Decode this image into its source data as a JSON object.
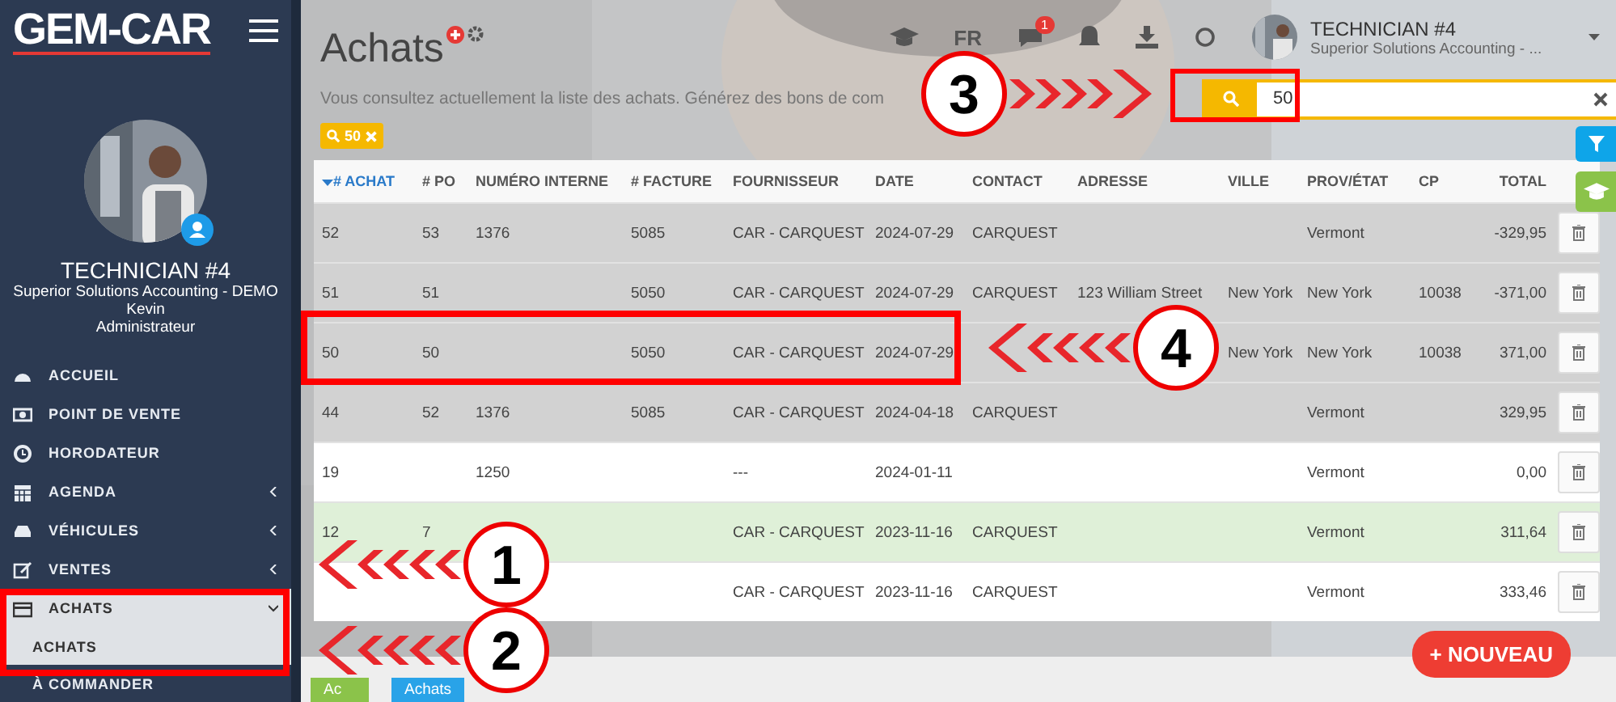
{
  "sidebar": {
    "logo": "GEM-CAR",
    "user_name": "TECHNICIAN #4",
    "company": "Superior Solutions Accounting - DEMO",
    "person": "Kevin",
    "role": "Administrateur",
    "menu": [
      {
        "label": "ACCUEIL",
        "kind": "link",
        "selected": false
      },
      {
        "label": "POINT DE VENTE",
        "kind": "link",
        "selected": false
      },
      {
        "label": "HORODATEUR",
        "kind": "link",
        "selected": false
      },
      {
        "label": "AGENDA",
        "kind": "group",
        "expanded": false,
        "selected": false
      },
      {
        "label": "VÉHICULES",
        "kind": "group",
        "expanded": false,
        "selected": false
      },
      {
        "label": "VENTES",
        "kind": "group",
        "expanded": false,
        "selected": false
      },
      {
        "label": "ACHATS",
        "kind": "group",
        "expanded": true,
        "selected": true,
        "children": [
          {
            "label": "ACHATS",
            "selected": true
          },
          {
            "label": "À COMMANDER",
            "selected": false
          }
        ]
      }
    ]
  },
  "header": {
    "language": "FR",
    "notification_count": "1",
    "user_name": "TECHNICIAN #4",
    "company": "Superior Solutions Accounting - ..."
  },
  "page": {
    "title": "Achats",
    "subtitle": "Vous consultez actuellement la liste des achats. Générez des bons de com",
    "filter_chip": "50"
  },
  "search": {
    "value": "50"
  },
  "table": {
    "columns": [
      {
        "label": "# ACHAT",
        "sorted": true
      },
      {
        "label": "# PO",
        "sorted": false
      },
      {
        "label": "NUMÉRO INTERNE",
        "sorted": false
      },
      {
        "label": "# FACTURE",
        "sorted": false
      },
      {
        "label": "FOURNISSEUR",
        "sorted": false
      },
      {
        "label": "DATE",
        "sorted": false
      },
      {
        "label": "CONTACT",
        "sorted": false
      },
      {
        "label": "ADRESSE",
        "sorted": false
      },
      {
        "label": "VILLE",
        "sorted": false
      },
      {
        "label": "PROV/ÉTAT",
        "sorted": false
      },
      {
        "label": "CP",
        "sorted": false
      },
      {
        "label": "TOTAL",
        "sorted": false
      }
    ],
    "rows": [
      {
        "color": "#d2d2d2",
        "cells": [
          "52",
          "53",
          "1376",
          "5085",
          "CAR - CARQUEST",
          "2024-07-29",
          "CARQUEST",
          null,
          null,
          "Vermont",
          null,
          "-329,95"
        ]
      },
      {
        "color": "#d2d2d2",
        "cells": [
          "51",
          "51",
          null,
          "5050",
          "CAR - CARQUEST",
          "2024-07-29",
          "CARQUEST",
          "123 William Street",
          "New York",
          "New York",
          "10038",
          "-371,00"
        ]
      },
      {
        "color": "#d2d2d2",
        "cells": [
          "50",
          "50",
          null,
          "5050",
          "CAR - CARQUEST",
          "2024-07-29",
          null,
          null,
          "New York",
          "New York",
          "10038",
          "371,00"
        ]
      },
      {
        "color": "#d2d2d2",
        "cells": [
          "44",
          "52",
          "1376",
          "5085",
          "CAR - CARQUEST",
          "2024-04-18",
          "CARQUEST",
          null,
          null,
          "Vermont",
          null,
          "329,95"
        ]
      },
      {
        "color": "#ffffff",
        "cells": [
          "19",
          null,
          "1250",
          null,
          "---",
          "2024-01-11",
          null,
          null,
          null,
          "Vermont",
          null,
          "0,00"
        ]
      },
      {
        "color": "#dff0d8",
        "cells": [
          "12",
          "7",
          null,
          null,
          "CAR - CARQUEST",
          "2023-11-16",
          "CARQUEST",
          null,
          null,
          "Vermont",
          null,
          "311,64"
        ]
      },
      {
        "color": "#ffffff",
        "cells": [
          null,
          null,
          null,
          null,
          "CAR - CARQUEST",
          "2023-11-16",
          "CARQUEST",
          null,
          null,
          "Vermont",
          null,
          "333,46"
        ]
      }
    ]
  },
  "new_button": "+ NOUVEAU",
  "bottom_tabs": [
    {
      "label": "Ac",
      "color": "#8bc34a"
    },
    {
      "label": "Achats",
      "color": "#29a3e8"
    }
  ],
  "annotations": [
    {
      "number": "1"
    },
    {
      "number": "2"
    },
    {
      "number": "3"
    },
    {
      "number": "4"
    }
  ]
}
